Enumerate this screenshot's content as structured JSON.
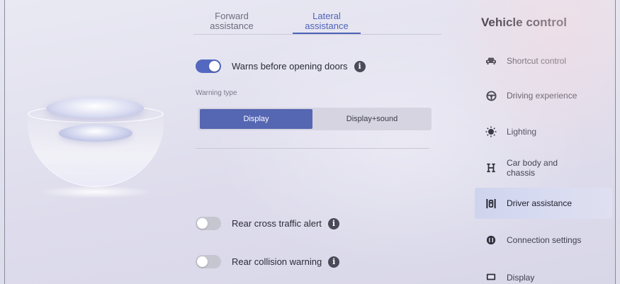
{
  "tabs": [
    {
      "label": "Forward\nassistance",
      "line1": "Forward",
      "line2": "assistance",
      "active": false
    },
    {
      "label": "Lateral\nassistance",
      "line1": "Lateral",
      "line2": "assistance",
      "active": true
    }
  ],
  "door_warning": {
    "label": "Warns before opening doors",
    "enabled": true
  },
  "warning_type": {
    "label": "Warning type",
    "options": [
      "Display",
      "Display+sound"
    ],
    "selected": "Display"
  },
  "rear_cross_traffic": {
    "label": "Rear cross traffic alert",
    "enabled": false
  },
  "rear_collision": {
    "label": "Rear collision warning",
    "enabled": false
  },
  "vehicle_control": {
    "title": "Vehicle control",
    "menu": [
      {
        "label": "Shortcut control",
        "icon": "car-icon"
      },
      {
        "label": "Driving experience",
        "icon": "steering-wheel-icon"
      },
      {
        "label": "Lighting",
        "icon": "light-icon"
      },
      {
        "label": "Car body and chassis",
        "line1": "Car body and",
        "line2": "chassis",
        "icon": "chassis-icon"
      },
      {
        "label": "Driver assistance",
        "icon": "driver-assist-icon",
        "active": true
      },
      {
        "label": "Connection settings",
        "icon": "connection-icon"
      },
      {
        "label": "Display",
        "icon": "display-icon"
      }
    ]
  },
  "colors": {
    "accent": "#5468c0",
    "active_tab": "#4e63b8",
    "toggle_off": "#c6c6d0"
  }
}
